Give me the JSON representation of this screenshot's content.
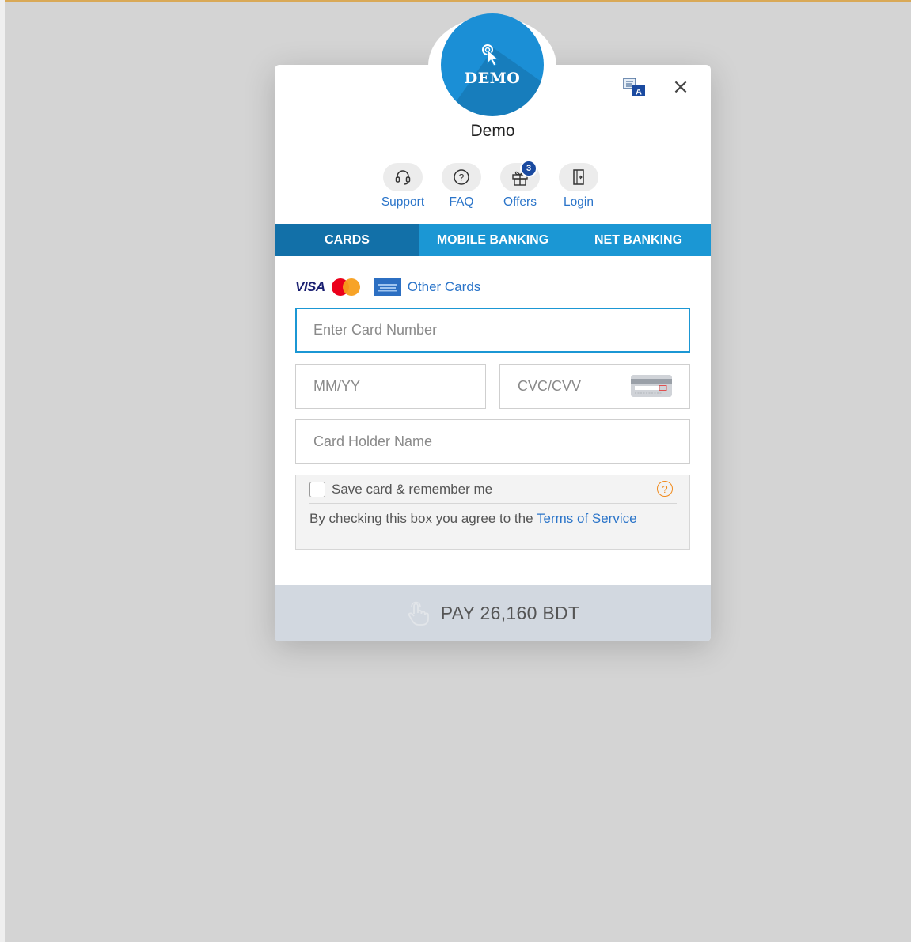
{
  "merchant": {
    "logo_text": "DEMO",
    "name": "Demo"
  },
  "quick_links": [
    {
      "label": "Support",
      "icon": "headset-icon"
    },
    {
      "label": "FAQ",
      "icon": "question-circle-icon"
    },
    {
      "label": "Offers",
      "icon": "gift-icon",
      "badge": "3"
    },
    {
      "label": "Login",
      "icon": "login-door-icon"
    }
  ],
  "tabs": [
    {
      "label": "CARDS",
      "active": true
    },
    {
      "label": "MOBILE BANKING",
      "active": false
    },
    {
      "label": "NET BANKING",
      "active": false
    }
  ],
  "card_brands": {
    "visa": "VISA",
    "other_cards": "Other Cards"
  },
  "form": {
    "card_number_placeholder": "Enter Card Number",
    "expiry_placeholder": "MM/YY",
    "cvc_placeholder": "CVC/CVV",
    "holder_placeholder": "Card Holder Name"
  },
  "save_card": {
    "label": "Save card & remember me",
    "checked": false,
    "help": "?",
    "terms_prefix": "By checking this box you agree to the ",
    "terms_link": "Terms of Service"
  },
  "pay": {
    "label": "PAY 26,160 BDT"
  },
  "close_symbol": "×",
  "colors": {
    "accent": "#1b97d4",
    "tab_active": "#1270a8",
    "link": "#2a74c9",
    "badge": "#1a4aa0",
    "help": "#f08a1c",
    "pay_bar": "#d2d8e0"
  }
}
